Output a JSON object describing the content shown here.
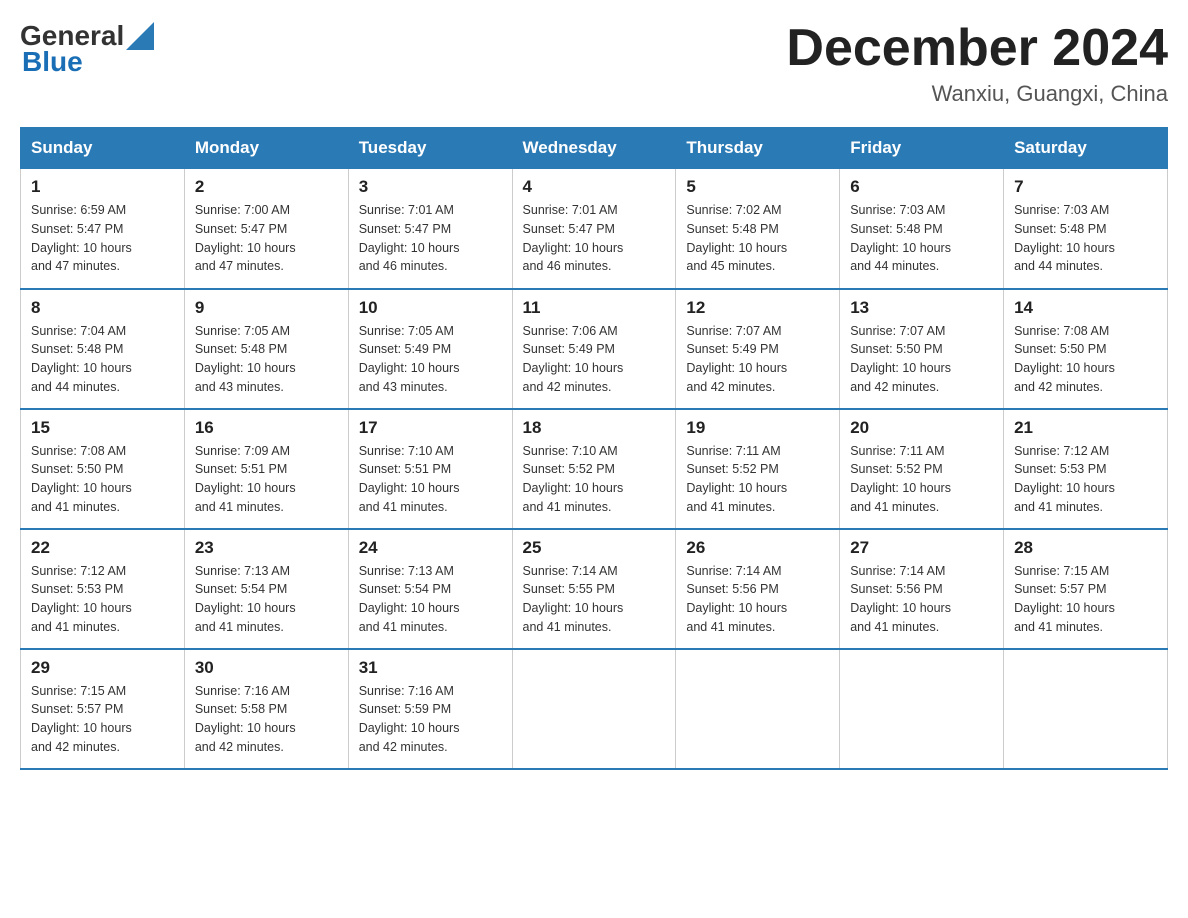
{
  "logo": {
    "general": "General",
    "blue": "Blue",
    "tagline": "GeneralBlue"
  },
  "header": {
    "title": "December 2024",
    "subtitle": "Wanxiu, Guangxi, China"
  },
  "weekdays": [
    "Sunday",
    "Monday",
    "Tuesday",
    "Wednesday",
    "Thursday",
    "Friday",
    "Saturday"
  ],
  "weeks": [
    [
      {
        "day": "1",
        "sunrise": "6:59 AM",
        "sunset": "5:47 PM",
        "daylight": "10 hours and 47 minutes."
      },
      {
        "day": "2",
        "sunrise": "7:00 AM",
        "sunset": "5:47 PM",
        "daylight": "10 hours and 47 minutes."
      },
      {
        "day": "3",
        "sunrise": "7:01 AM",
        "sunset": "5:47 PM",
        "daylight": "10 hours and 46 minutes."
      },
      {
        "day": "4",
        "sunrise": "7:01 AM",
        "sunset": "5:47 PM",
        "daylight": "10 hours and 46 minutes."
      },
      {
        "day": "5",
        "sunrise": "7:02 AM",
        "sunset": "5:48 PM",
        "daylight": "10 hours and 45 minutes."
      },
      {
        "day": "6",
        "sunrise": "7:03 AM",
        "sunset": "5:48 PM",
        "daylight": "10 hours and 44 minutes."
      },
      {
        "day": "7",
        "sunrise": "7:03 AM",
        "sunset": "5:48 PM",
        "daylight": "10 hours and 44 minutes."
      }
    ],
    [
      {
        "day": "8",
        "sunrise": "7:04 AM",
        "sunset": "5:48 PM",
        "daylight": "10 hours and 44 minutes."
      },
      {
        "day": "9",
        "sunrise": "7:05 AM",
        "sunset": "5:48 PM",
        "daylight": "10 hours and 43 minutes."
      },
      {
        "day": "10",
        "sunrise": "7:05 AM",
        "sunset": "5:49 PM",
        "daylight": "10 hours and 43 minutes."
      },
      {
        "day": "11",
        "sunrise": "7:06 AM",
        "sunset": "5:49 PM",
        "daylight": "10 hours and 42 minutes."
      },
      {
        "day": "12",
        "sunrise": "7:07 AM",
        "sunset": "5:49 PM",
        "daylight": "10 hours and 42 minutes."
      },
      {
        "day": "13",
        "sunrise": "7:07 AM",
        "sunset": "5:50 PM",
        "daylight": "10 hours and 42 minutes."
      },
      {
        "day": "14",
        "sunrise": "7:08 AM",
        "sunset": "5:50 PM",
        "daylight": "10 hours and 42 minutes."
      }
    ],
    [
      {
        "day": "15",
        "sunrise": "7:08 AM",
        "sunset": "5:50 PM",
        "daylight": "10 hours and 41 minutes."
      },
      {
        "day": "16",
        "sunrise": "7:09 AM",
        "sunset": "5:51 PM",
        "daylight": "10 hours and 41 minutes."
      },
      {
        "day": "17",
        "sunrise": "7:10 AM",
        "sunset": "5:51 PM",
        "daylight": "10 hours and 41 minutes."
      },
      {
        "day": "18",
        "sunrise": "7:10 AM",
        "sunset": "5:52 PM",
        "daylight": "10 hours and 41 minutes."
      },
      {
        "day": "19",
        "sunrise": "7:11 AM",
        "sunset": "5:52 PM",
        "daylight": "10 hours and 41 minutes."
      },
      {
        "day": "20",
        "sunrise": "7:11 AM",
        "sunset": "5:52 PM",
        "daylight": "10 hours and 41 minutes."
      },
      {
        "day": "21",
        "sunrise": "7:12 AM",
        "sunset": "5:53 PM",
        "daylight": "10 hours and 41 minutes."
      }
    ],
    [
      {
        "day": "22",
        "sunrise": "7:12 AM",
        "sunset": "5:53 PM",
        "daylight": "10 hours and 41 minutes."
      },
      {
        "day": "23",
        "sunrise": "7:13 AM",
        "sunset": "5:54 PM",
        "daylight": "10 hours and 41 minutes."
      },
      {
        "day": "24",
        "sunrise": "7:13 AM",
        "sunset": "5:54 PM",
        "daylight": "10 hours and 41 minutes."
      },
      {
        "day": "25",
        "sunrise": "7:14 AM",
        "sunset": "5:55 PM",
        "daylight": "10 hours and 41 minutes."
      },
      {
        "day": "26",
        "sunrise": "7:14 AM",
        "sunset": "5:56 PM",
        "daylight": "10 hours and 41 minutes."
      },
      {
        "day": "27",
        "sunrise": "7:14 AM",
        "sunset": "5:56 PM",
        "daylight": "10 hours and 41 minutes."
      },
      {
        "day": "28",
        "sunrise": "7:15 AM",
        "sunset": "5:57 PM",
        "daylight": "10 hours and 41 minutes."
      }
    ],
    [
      {
        "day": "29",
        "sunrise": "7:15 AM",
        "sunset": "5:57 PM",
        "daylight": "10 hours and 42 minutes."
      },
      {
        "day": "30",
        "sunrise": "7:16 AM",
        "sunset": "5:58 PM",
        "daylight": "10 hours and 42 minutes."
      },
      {
        "day": "31",
        "sunrise": "7:16 AM",
        "sunset": "5:59 PM",
        "daylight": "10 hours and 42 minutes."
      },
      null,
      null,
      null,
      null
    ]
  ],
  "labels": {
    "sunrise": "Sunrise:",
    "sunset": "Sunset:",
    "daylight": "Daylight:"
  }
}
